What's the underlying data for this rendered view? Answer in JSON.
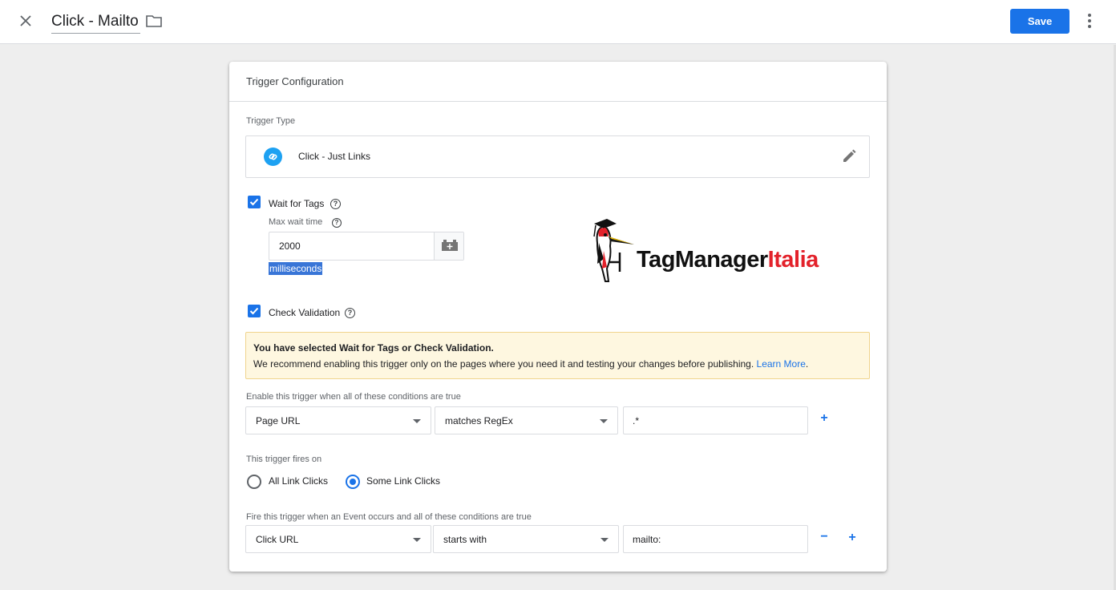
{
  "header": {
    "title": "Click - Mailto",
    "save_label": "Save"
  },
  "card": {
    "title": "Trigger Configuration",
    "trigger_type_label": "Trigger Type",
    "trigger_type_value": "Click - Just Links",
    "wait_for_tags": {
      "label": "Wait for Tags",
      "checked": true,
      "max_wait_label": "Max wait time",
      "max_wait_value": "2000",
      "unit": "milliseconds"
    },
    "check_validation": {
      "label": "Check Validation",
      "checked": true
    },
    "warning": {
      "title": "You have selected Wait for Tags or Check Validation.",
      "body": "We recommend enabling this trigger only on the pages where you need it and testing your changes before publishing.",
      "link": "Learn More",
      "link_suffix": "."
    },
    "enable_conditions": {
      "label": "Enable this trigger when all of these conditions are true",
      "variable": "Page URL",
      "operator": "matches RegEx",
      "value": ".*"
    },
    "fires_on": {
      "label": "This trigger fires on",
      "options": [
        "All Link Clicks",
        "Some Link Clicks"
      ],
      "selected": "Some Link Clicks"
    },
    "fire_conditions": {
      "label": "Fire this trigger when an Event occurs and all of these conditions are true",
      "variable": "Click URL",
      "operator": "starts with",
      "value": "mailto:"
    }
  },
  "logo": {
    "text_part1": "TagManager",
    "text_part2": "Italia",
    "color_dark": "#111111",
    "color_accent": "#e3222b"
  },
  "colors": {
    "accent": "#1a73e8",
    "warning_bg": "#fef7e0"
  }
}
